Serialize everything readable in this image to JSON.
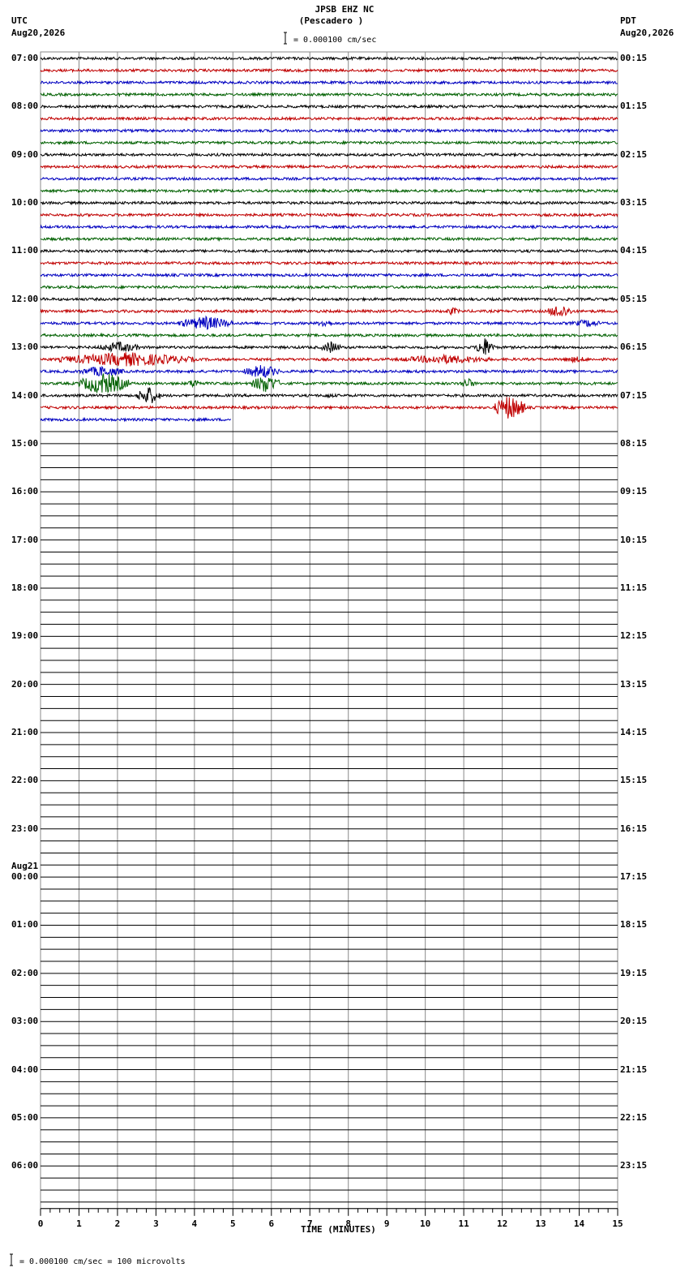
{
  "header": {
    "station": "JPSB EHZ NC",
    "location": "(Pescadero )",
    "scale_text": "= 0.000100 cm/sec",
    "left_tz": "UTC",
    "left_date": "Aug20,2026",
    "right_tz": "PDT",
    "right_date": "Aug20,2026",
    "next_date": "Aug21"
  },
  "footer": {
    "scale_text": "= 0.000100 cm/sec =     100 microvolts"
  },
  "chart_data": {
    "type": "line",
    "title": "JPSB EHZ NC (Pescadero )",
    "xlabel": "TIME (MINUTES)",
    "ylabel": "",
    "xlim": [
      0,
      15
    ],
    "x_ticks": [
      "0",
      "1",
      "2",
      "3",
      "4",
      "5",
      "6",
      "7",
      "8",
      "9",
      "10",
      "11",
      "12",
      "13",
      "14",
      "15"
    ],
    "rows_per_hour": 4,
    "total_rows": 96,
    "utc_hour_labels": [
      "07:00",
      "08:00",
      "09:00",
      "10:00",
      "11:00",
      "12:00",
      "13:00",
      "14:00",
      "15:00",
      "16:00",
      "17:00",
      "18:00",
      "19:00",
      "20:00",
      "21:00",
      "22:00",
      "23:00",
      "00:00",
      "01:00",
      "02:00",
      "03:00",
      "04:00",
      "05:00",
      "06:00"
    ],
    "pdt_hour_labels": [
      "00:15",
      "01:15",
      "02:15",
      "03:15",
      "04:15",
      "05:15",
      "06:15",
      "07:15",
      "08:15",
      "09:15",
      "10:15",
      "11:15",
      "12:15",
      "13:15",
      "14:15",
      "15:15",
      "16:15",
      "17:15",
      "18:15",
      "19:15",
      "20:15",
      "21:15",
      "22:15",
      "23:15"
    ],
    "trace_colors": [
      "#000000",
      "#c00000",
      "#0000c0",
      "#006000"
    ],
    "recorded_rows": 31,
    "last_row_end_minute": 4.95,
    "events": [
      {
        "row": 22,
        "start": 3.6,
        "end": 5.0,
        "amp": 9
      },
      {
        "row": 22,
        "start": 7.2,
        "end": 7.6,
        "amp": 6
      },
      {
        "row": 22,
        "start": 13.8,
        "end": 14.6,
        "amp": 5
      },
      {
        "row": 21,
        "start": 10.5,
        "end": 10.9,
        "amp": 5
      },
      {
        "row": 21,
        "start": 13.2,
        "end": 13.8,
        "amp": 10
      },
      {
        "row": 24,
        "start": 1.5,
        "end": 2.6,
        "amp": 7
      },
      {
        "row": 24,
        "start": 7.3,
        "end": 7.8,
        "amp": 8
      },
      {
        "row": 24,
        "start": 11.3,
        "end": 11.8,
        "amp": 12
      },
      {
        "row": 25,
        "start": 0.5,
        "end": 4.0,
        "amp": 9
      },
      {
        "row": 25,
        "start": 9.3,
        "end": 11.7,
        "amp": 6
      },
      {
        "row": 25,
        "start": 13.5,
        "end": 14.3,
        "amp": 4
      },
      {
        "row": 26,
        "start": 1.0,
        "end": 2.2,
        "amp": 7
      },
      {
        "row": 26,
        "start": 5.3,
        "end": 6.2,
        "amp": 9
      },
      {
        "row": 27,
        "start": 1.0,
        "end": 2.3,
        "amp": 14
      },
      {
        "row": 27,
        "start": 3.8,
        "end": 4.2,
        "amp": 6
      },
      {
        "row": 27,
        "start": 5.5,
        "end": 6.2,
        "amp": 12
      },
      {
        "row": 27,
        "start": 10.9,
        "end": 11.3,
        "amp": 7
      },
      {
        "row": 28,
        "start": 2.5,
        "end": 3.1,
        "amp": 12
      },
      {
        "row": 28,
        "start": 7.2,
        "end": 7.8,
        "amp": 3
      },
      {
        "row": 29,
        "start": 11.8,
        "end": 12.6,
        "amp": 16
      }
    ]
  }
}
